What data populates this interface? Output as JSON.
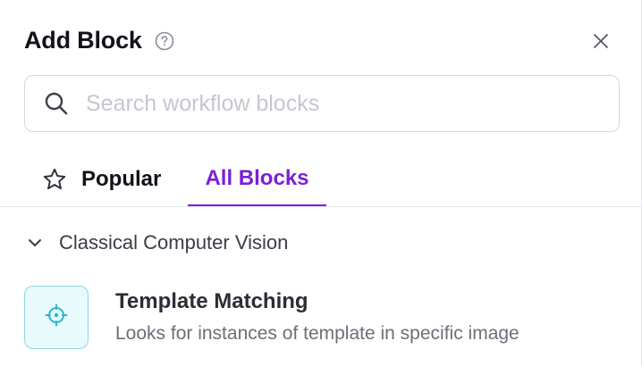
{
  "header": {
    "title": "Add Block",
    "help_icon": "help-circle-icon",
    "close_icon": "close-icon"
  },
  "search": {
    "value": "",
    "placeholder": "Search workflow blocks",
    "icon": "search-icon"
  },
  "tabs": [
    {
      "label": "Popular",
      "icon": "star-icon",
      "active": false
    },
    {
      "label": "All Blocks",
      "active": true
    }
  ],
  "colors": {
    "accent": "#7c1fd6",
    "block_icon_bg": "#e9fafd",
    "block_icon_border": "#8fd6e3",
    "block_icon_fg": "#2bb7cf"
  },
  "category": {
    "label": "Classical Computer Vision",
    "expanded": true,
    "icon": "chevron-down-icon"
  },
  "blocks": [
    {
      "title": "Template Matching",
      "description": "Looks for instances of template in specific image",
      "icon": "crosshair-icon"
    }
  ]
}
